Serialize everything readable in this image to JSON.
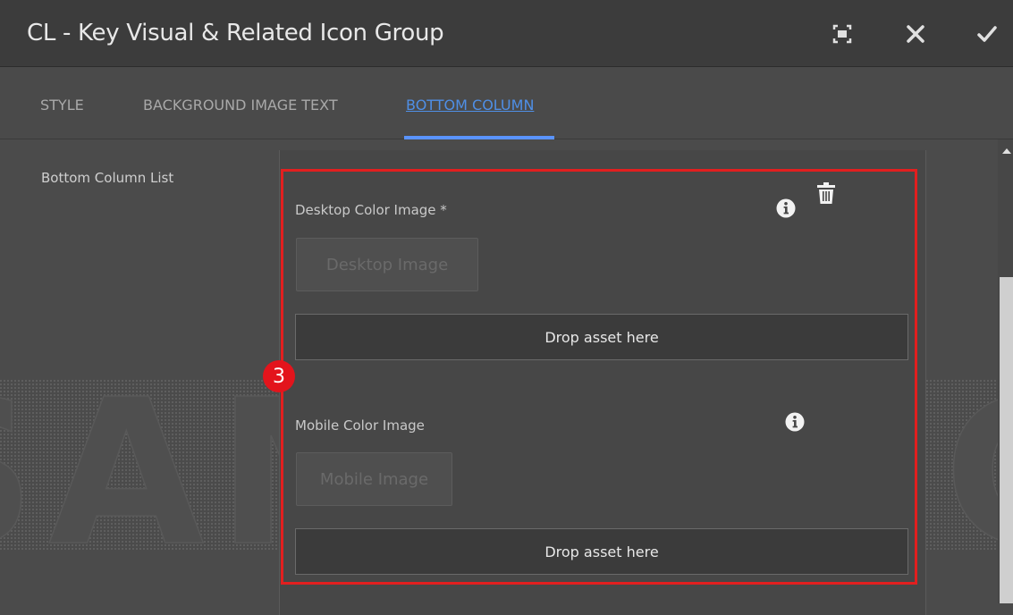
{
  "dialog": {
    "title": "CL - Key Visual & Related Icon Group",
    "actions": [
      "fullscreen-icon",
      "close-icon",
      "check-icon"
    ]
  },
  "tabs": [
    {
      "label": "STYLE",
      "active": false
    },
    {
      "label": "BACKGROUND IMAGE TEXT",
      "active": false
    },
    {
      "label": "BOTTOM COLUMN",
      "active": true
    }
  ],
  "field": {
    "label": "Bottom Column List"
  },
  "badge": "3",
  "desktop": {
    "label": "Desktop Color Image *",
    "button": "Desktop Image",
    "drop": "Drop asset here"
  },
  "mobile": {
    "label": "Mobile Color Image",
    "button": "Mobile Image",
    "drop": "Drop asset here"
  },
  "colors": {
    "accent": "#5a93ff",
    "highlight": "#e21f1f",
    "badge": "#e3141c"
  }
}
